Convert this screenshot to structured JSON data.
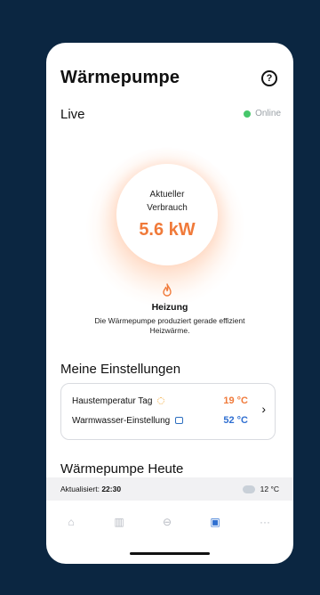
{
  "header": {
    "title": "Wärmepumpe",
    "help_icon": "question-circle-icon",
    "help_symbol": "?"
  },
  "live": {
    "label": "Live",
    "status": "Online",
    "status_color": "#47c76b"
  },
  "consumption": {
    "label": "Aktueller Verbrauch",
    "value": "5.6 kW",
    "accent": "#f07a3a"
  },
  "mode": {
    "icon": "flame-icon",
    "label": "Heizung",
    "description": "Die Wärmepumpe produziert gerade effizient Heizwärme."
  },
  "settings": {
    "title": "Meine Einstellungen",
    "rows": [
      {
        "label": "Haustemperatur Tag",
        "icon": "sun-icon",
        "value": "19 °C",
        "color": "#f07a3a"
      },
      {
        "label": "Warmwasser-Einstellung",
        "icon": "water-icon",
        "value": "52 °C",
        "color": "#2f6fd1"
      }
    ],
    "chevron": "›"
  },
  "today": {
    "title": "Wärmepumpe Heute"
  },
  "update": {
    "prefix": "Aktualisiert:",
    "time": "22:30",
    "weather_icon": "cloud-sun-icon",
    "temperature": "12 °C"
  },
  "tabbar": {
    "items": [
      {
        "icon": "home-icon",
        "symbol": "⌂",
        "active": false
      },
      {
        "icon": "chart-icon",
        "symbol": "▥",
        "active": false
      },
      {
        "icon": "car-icon",
        "symbol": "⊖",
        "active": false
      },
      {
        "icon": "heatpump-icon",
        "symbol": "▣",
        "active": true
      },
      {
        "icon": "more-icon",
        "symbol": "···",
        "active": false
      }
    ]
  }
}
